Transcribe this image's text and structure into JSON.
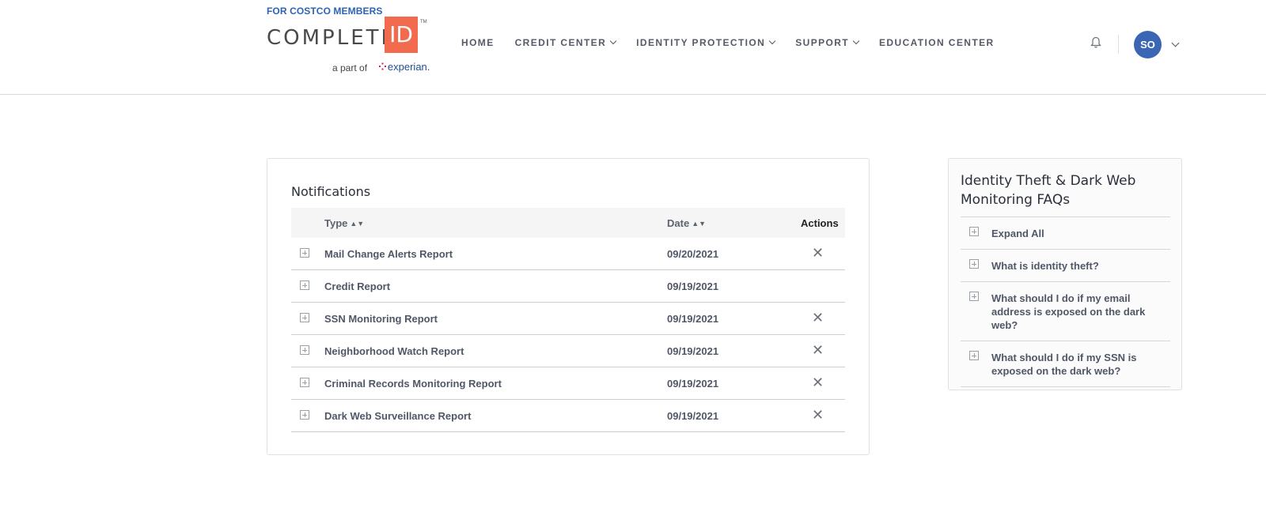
{
  "header": {
    "members_label": "FOR COSTCO MEMBERS",
    "brand_word": "COMPLETE",
    "brand_id": "ID",
    "brand_tm": "TM",
    "part_of": "a part of",
    "partner": "experian."
  },
  "nav": {
    "items": [
      {
        "label": "HOME",
        "dropdown": false
      },
      {
        "label": "CREDIT CENTER",
        "dropdown": true
      },
      {
        "label": "IDENTITY PROTECTION",
        "dropdown": true
      },
      {
        "label": "SUPPORT",
        "dropdown": true
      },
      {
        "label": "EDUCATION CENTER",
        "dropdown": false
      }
    ]
  },
  "user": {
    "initials": "SO",
    "avatar_color": "#3a66b3"
  },
  "notifications": {
    "title": "Notifications",
    "columns": {
      "type": "Type",
      "date": "Date",
      "actions": "Actions"
    },
    "rows": [
      {
        "type": "Mail Change Alerts Report",
        "date": "09/20/2021",
        "dismiss": "✕"
      },
      {
        "type": "Credit Report",
        "date": "09/19/2021",
        "dismiss": ""
      },
      {
        "type": "SSN Monitoring Report",
        "date": "09/19/2021",
        "dismiss": "✕"
      },
      {
        "type": "Neighborhood Watch Report",
        "date": "09/19/2021",
        "dismiss": "✕"
      },
      {
        "type": "Criminal Records Monitoring Report",
        "date": "09/19/2021",
        "dismiss": "✕"
      },
      {
        "type": "Dark Web Surveillance Report",
        "date": "09/19/2021",
        "dismiss": "✕"
      }
    ]
  },
  "faq": {
    "title": "Identity Theft & Dark Web Monitoring FAQs",
    "items": [
      {
        "label": "Expand All"
      },
      {
        "label": "What is identity theft?"
      },
      {
        "label": "What should I do if my email address is exposed on the dark web?"
      },
      {
        "label": "What should I do if my SSN is exposed on the dark web?"
      }
    ]
  },
  "colors": {
    "brand_orange": "#f26b4f",
    "brand_blue": "#2b63b6"
  }
}
